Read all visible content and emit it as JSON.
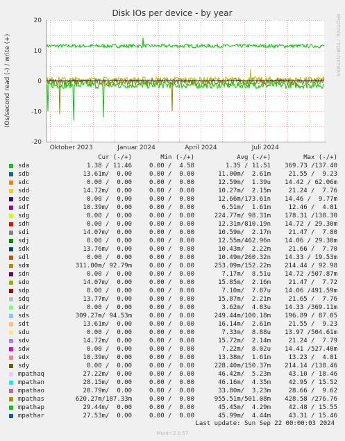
{
  "chart_data": {
    "type": "line",
    "title": "Disk IOs per device - by year",
    "ylabel": "IOs/second read (-) / write (+)",
    "side_label": "RRDTOOL / TOBI OETIKER",
    "ylim": [
      -20,
      20
    ],
    "yticks": [
      "20",
      "10",
      "0",
      "-10",
      "-20"
    ],
    "ytick_values": [
      20,
      10,
      0,
      -10,
      -20
    ],
    "xlim": [
      "2023-08-27",
      "2024-09-22"
    ],
    "xticks": [
      {
        "label": "Oktober 2023",
        "date": "2023-10-01"
      },
      {
        "label": "Januar 2024",
        "date": "2024-01-01"
      },
      {
        "label": "April 2024",
        "date": "2024-04-01"
      },
      {
        "label": "Juli 2024",
        "date": "2024-07-01"
      }
    ],
    "series": [
      {
        "name": "sda (write)",
        "color": "#00cc00",
        "typical": 11.5,
        "spikes": [
          {
            "date": "2024-01-10",
            "value": 14.2
          }
        ]
      },
      {
        "name": "sda (read)",
        "color": "#00cc00",
        "typical": -1.4,
        "spikes": [
          {
            "date": "2023-08-29",
            "value": -10
          },
          {
            "date": "2023-10-04",
            "value": -13
          },
          {
            "date": "2023-11-15",
            "value": -12
          }
        ]
      },
      {
        "name": "sdm (write)",
        "color": "#ccbb00",
        "typical": 0.3,
        "spikes": [
          {
            "date": "2024-06-10",
            "value": 4
          }
        ]
      },
      {
        "name": "sdm (read)",
        "color": "#888800",
        "typical": -0.3,
        "spikes": [
          {
            "date": "2024-02-20",
            "value": -10
          },
          {
            "date": "2023-09-15",
            "value": -11
          }
        ]
      }
    ]
  },
  "legend": {
    "headers": {
      "cur": "Cur (-/+)",
      "min": "Min (-/+)",
      "avg": "Avg (-/+)",
      "max": "Max (-/+)"
    },
    "rows": [
      {
        "name": "sda",
        "color": "#00cc00",
        "cur": "1.38 / 11.46",
        "min": "0.00 /  4.58",
        "avg": "1.35 / 11.51",
        "max": "369.73 /137.40"
      },
      {
        "name": "sdb",
        "color": "#0066b3",
        "cur": "13.61m/  0.00",
        "min": "0.00 /  0.00",
        "avg": "11.00m/  2.61m",
        "max": "21.55 /  9.23"
      },
      {
        "name": "sdc",
        "color": "#ff8000",
        "cur": "0.00 /  0.00",
        "min": "0.00 /  0.00",
        "avg": "12.59m/  1.39u",
        "max": "14.42 / 62.06m"
      },
      {
        "name": "sdd",
        "color": "#ffcc00",
        "cur": "14.72m/  0.00",
        "min": "0.00 /  0.00",
        "avg": "10.27m/  2.15m",
        "max": "21.24 /  7.76"
      },
      {
        "name": "sde",
        "color": "#330099",
        "cur": "0.00 /  0.00",
        "min": "0.00 /  0.00",
        "avg": "12.66m/173.61n",
        "max": "14.46 /  9.77m"
      },
      {
        "name": "sdf",
        "color": "#990099",
        "cur": "10.39m/  0.00",
        "min": "0.00 /  0.00",
        "avg": "6.51m/  1.61m",
        "max": "12.46 /  4.81"
      },
      {
        "name": "sdg",
        "color": "#ccff00",
        "cur": "0.00 /  0.00",
        "min": "0.00 /  0.00",
        "avg": "224.77m/ 98.31m",
        "max": "178.31 /138.30"
      },
      {
        "name": "sdh",
        "color": "#ff0000",
        "cur": "0.00 /  0.00",
        "min": "0.00 /  0.00",
        "avg": "12.31m/810.19n",
        "max": "14.72 / 29.30m"
      },
      {
        "name": "sdi",
        "color": "#808080",
        "cur": "14.07m/  0.00",
        "min": "0.00 /  0.00",
        "avg": "10.59m/  2.17m",
        "max": "21.47 /  7.80"
      },
      {
        "name": "sdj",
        "color": "#008f00",
        "cur": "0.00 /  0.00",
        "min": "0.00 /  0.00",
        "avg": "12.55m/462.96n",
        "max": "14.06 / 29.30m"
      },
      {
        "name": "sdk",
        "color": "#00487d",
        "cur": "13.76m/  0.00",
        "min": "0.00 /  0.00",
        "avg": "10.43m/  2.22m",
        "max": "21.66 /  7.70"
      },
      {
        "name": "sdl",
        "color": "#b35a00",
        "cur": "0.00 /  0.00",
        "min": "0.00 /  0.00",
        "avg": "10.49m/260.32n",
        "max": "14.33 / 19.53m"
      },
      {
        "name": "sdm",
        "color": "#b38f00",
        "cur": "311.00m/ 92.79m",
        "min": "0.00 /  0.00",
        "avg": "253.09m/152.22m",
        "max": "214.44 / 92.98"
      },
      {
        "name": "sdn",
        "color": "#6b006b",
        "cur": "0.00 /  0.00",
        "min": "0.00 /  0.00",
        "avg": "7.17m/  8.51u",
        "max": "14.72 /507.87m"
      },
      {
        "name": "sdo",
        "color": "#8fb300",
        "cur": "14.07m/  0.00",
        "min": "0.00 /  0.00",
        "avg": "15.85m/  2.16m",
        "max": "21.47 /  7.72"
      },
      {
        "name": "sdp",
        "color": "#b30000",
        "cur": "0.00 /  0.00",
        "min": "0.00 /  0.00",
        "avg": "7.10m/  7.87u",
        "max": "14.06 /491.59m"
      },
      {
        "name": "sdq",
        "color": "#bebebe",
        "cur": "13.77m/  0.00",
        "min": "0.00 /  0.00",
        "avg": "15.87m/  2.21m",
        "max": "21.65 /  7.76"
      },
      {
        "name": "sdr",
        "color": "#80ff80",
        "cur": "0.00 /  0.00",
        "min": "0.00 /  0.00",
        "avg": "3.62m/  4.83u",
        "max": "14.33 /369.11m"
      },
      {
        "name": "sds",
        "color": "#80c9ff",
        "cur": "309.27m/ 94.53m",
        "min": "0.00 /  0.00",
        "avg": "249.44m/100.18m",
        "max": "196.89 / 87.05"
      },
      {
        "name": "sdt",
        "color": "#ffc080",
        "cur": "13.61m/  0.00",
        "min": "0.00 /  0.00",
        "avg": "16.14m/  2.61m",
        "max": "21.55 /  9.23"
      },
      {
        "name": "sdu",
        "color": "#ffe680",
        "cur": "0.00 /  0.00",
        "min": "0.00 /  0.00",
        "avg": "7.33m/  8.88u",
        "max": "13.97 /504.61m"
      },
      {
        "name": "sdv",
        "color": "#aa80ff",
        "cur": "14.72m/  0.00",
        "min": "0.00 /  0.00",
        "avg": "15.72m/  2.14m",
        "max": "21.24 /  7.79"
      },
      {
        "name": "sdw",
        "color": "#ee00cc",
        "cur": "0.00 /  0.00",
        "min": "0.00 /  0.00",
        "avg": "7.22m/  8.02u",
        "max": "14.41 /527.40m"
      },
      {
        "name": "sdx",
        "color": "#ff8080",
        "cur": "10.39m/  0.00",
        "min": "0.00 /  0.00",
        "avg": "13.38m/  1.61m",
        "max": "13.23 /  4.81"
      },
      {
        "name": "sdy",
        "color": "#666600",
        "cur": "0.00 /  0.00",
        "min": "0.00 /  0.00",
        "avg": "228.40m/150.37m",
        "max": "214.14 /138.46"
      },
      {
        "name": "mpathaq",
        "color": "#ffbfff",
        "cur": "27.22m/  0.00",
        "min": "0.00 /  0.00",
        "avg": "46.42m/  5.23m",
        "max": "43.10 / 18.46"
      },
      {
        "name": "mpathan",
        "color": "#00ffcc",
        "cur": "28.15m/  0.00",
        "min": "0.00 /  0.00",
        "avg": "46.16m/  4.35m",
        "max": "42.95 / 15.52"
      },
      {
        "name": "mpathao",
        "color": "#cc6699",
        "cur": "20.79m/  0.00",
        "min": "0.00 /  0.00",
        "avg": "33.80m/  3.23m",
        "max": "28.66 /  9.62"
      },
      {
        "name": "mpathas",
        "color": "#999900",
        "cur": "620.27m/187.33m",
        "min": "0.00 /  0.00",
        "avg": "955.51m/501.08m",
        "max": "428.58 /276.76"
      },
      {
        "name": "mpathap",
        "color": "#00cc00",
        "cur": "29.44m/  0.00",
        "min": "0.00 /  0.00",
        "avg": "45.45m/  4.29m",
        "max": "42.48 / 15.55"
      },
      {
        "name": "mpathar",
        "color": "#0066b3",
        "cur": "27.53m/  0.00",
        "min": "0.00 /  0.00",
        "avg": "45.99m/  4.44m",
        "max": "43.31 / 15.46"
      }
    ]
  },
  "last_update": "Last update: Sun Sep 22 00:00:03 2024",
  "footer": "Munin 2.0.57"
}
